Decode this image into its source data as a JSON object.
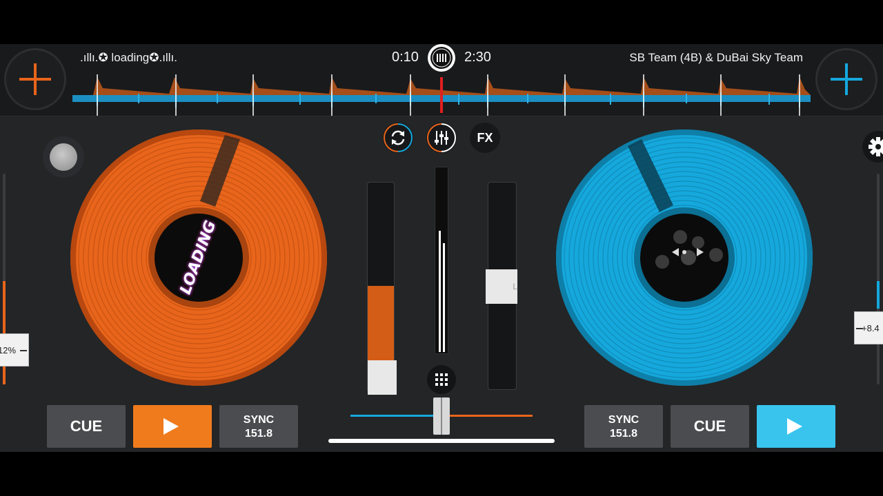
{
  "deck_left": {
    "track_title": ".ıllı.✪ loading✪.ıllı.",
    "platter_label": "LOADING",
    "pitch_value": "12%",
    "cue_label": "CUE",
    "sync_label": "SYNC",
    "bpm": "151.8",
    "color": "#e8651b"
  },
  "deck_right": {
    "track_title": "SB Team (4B) & DuBai Sky Team",
    "pitch_value": "+8.4",
    "volume_knob_label": "L",
    "cue_label": "CUE",
    "sync_label": "SYNC",
    "bpm": "151.8",
    "color": "#15a8dc"
  },
  "transport": {
    "elapsed": "0:10",
    "total": "2:30"
  },
  "mixer": {
    "fx_label": "FX",
    "buttons": [
      "loop-icon",
      "mixer-sliders-icon",
      "fx"
    ]
  }
}
